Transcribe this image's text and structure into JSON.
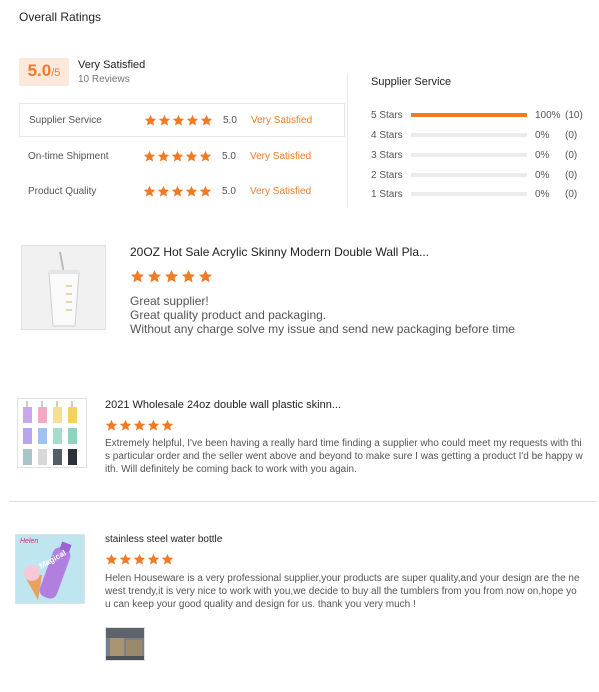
{
  "page_title": "Overall Ratings",
  "summary": {
    "score": "5.0",
    "max": "/5",
    "label": "Very Satisfied",
    "reviews": "10 Reviews"
  },
  "categories": [
    {
      "name": "Supplier Service",
      "score": "5.0",
      "text": "Very Satisfied",
      "stars": 5
    },
    {
      "name": "On-time Shipment",
      "score": "5.0",
      "text": "Very Satisfied",
      "stars": 5
    },
    {
      "name": "Product Quality",
      "score": "5.0",
      "text": "Very Satisfied",
      "stars": 5
    }
  ],
  "distribution": {
    "title": "Supplier Service",
    "rows": [
      {
        "label": "5 Stars",
        "pct": "100%",
        "count": "(10)",
        "fraction": 1.0
      },
      {
        "label": "4 Stars",
        "pct": "0%",
        "count": "(0)",
        "fraction": 0
      },
      {
        "label": "3 Stars",
        "pct": "0%",
        "count": "(0)",
        "fraction": 0
      },
      {
        "label": "2 Stars",
        "pct": "0%",
        "count": "(0)",
        "fraction": 0
      },
      {
        "label": "1 Stars",
        "pct": "0%",
        "count": "(0)",
        "fraction": 0
      }
    ]
  },
  "reviews": [
    {
      "product": "20OZ Hot Sale Acrylic Skinny Modern Double Wall Pla...",
      "stars": 5,
      "lines": [
        "Great supplier!",
        "Great quality product and packaging.",
        "Without any charge solve my issue and send new packaging before time"
      ]
    },
    {
      "product": "2021 Wholesale 24oz double wall plastic skinn...",
      "stars": 5,
      "lines": [
        "Extremely helpful, I've been having a really hard time finding a supplier who could meet my requests with thi",
        "s particular order and the seller went above and beyond to make sure I was getting a product I'd be happy w",
        "ith. Will definitely be coming back to work with you again."
      ]
    },
    {
      "product": "stainless steel water bottle",
      "stars": 5,
      "lines": [
        "Helen Houseware is a very professional supplier,your products are super quality,and your design are the ne",
        "west trendy,it is very nice to work with you,we decide to buy all the tumblers from you from now on,hope yo",
        "u can keep your good quality and design for us. thank you very much !"
      ],
      "thumb_text": "Helen",
      "thumb_brand": "Magical"
    }
  ],
  "colors": {
    "accent": "#f07b24",
    "score_bg": "#fde9dc"
  }
}
